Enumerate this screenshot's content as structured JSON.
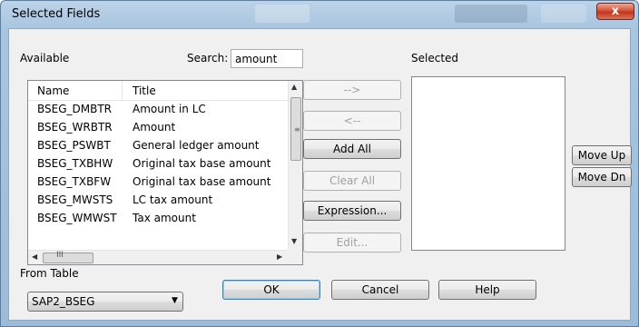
{
  "window": {
    "title": "Selected Fields",
    "close_label": "x"
  },
  "labels": {
    "available": "Available",
    "search": "Search:",
    "selected": "Selected",
    "from_table": "From Table"
  },
  "search": {
    "value": "amount"
  },
  "list": {
    "headers": {
      "name": "Name",
      "title": "Title"
    },
    "rows": [
      {
        "name": "BSEG_DMBTR",
        "title": "Amount in LC"
      },
      {
        "name": "BSEG_WRBTR",
        "title": "Amount"
      },
      {
        "name": "BSEG_PSWBT",
        "title": "General ledger amount"
      },
      {
        "name": "BSEG_TXBHW",
        "title": "Original tax base amount"
      },
      {
        "name": "BSEG_TXBFW",
        "title": "Original tax base amount"
      },
      {
        "name": "BSEG_MWSTS",
        "title": "LC tax amount"
      },
      {
        "name": "BSEG_WMWST",
        "title": "Tax amount"
      }
    ],
    "hscroll_grip": "III"
  },
  "buttons": {
    "add": "-->",
    "remove": "<--",
    "add_all": "Add All",
    "clear_all": "Clear All",
    "expression": "Expression...",
    "edit": "Edit...",
    "move_up": "Move Up",
    "move_dn": "Move Dn",
    "ok": "OK",
    "cancel": "Cancel",
    "help": "Help"
  },
  "from_table": {
    "value": "SAP2_BSEG"
  },
  "colors": {
    "title_bar": "#a9c5df",
    "close": "#c2351b",
    "client": "#f0f0f0"
  }
}
